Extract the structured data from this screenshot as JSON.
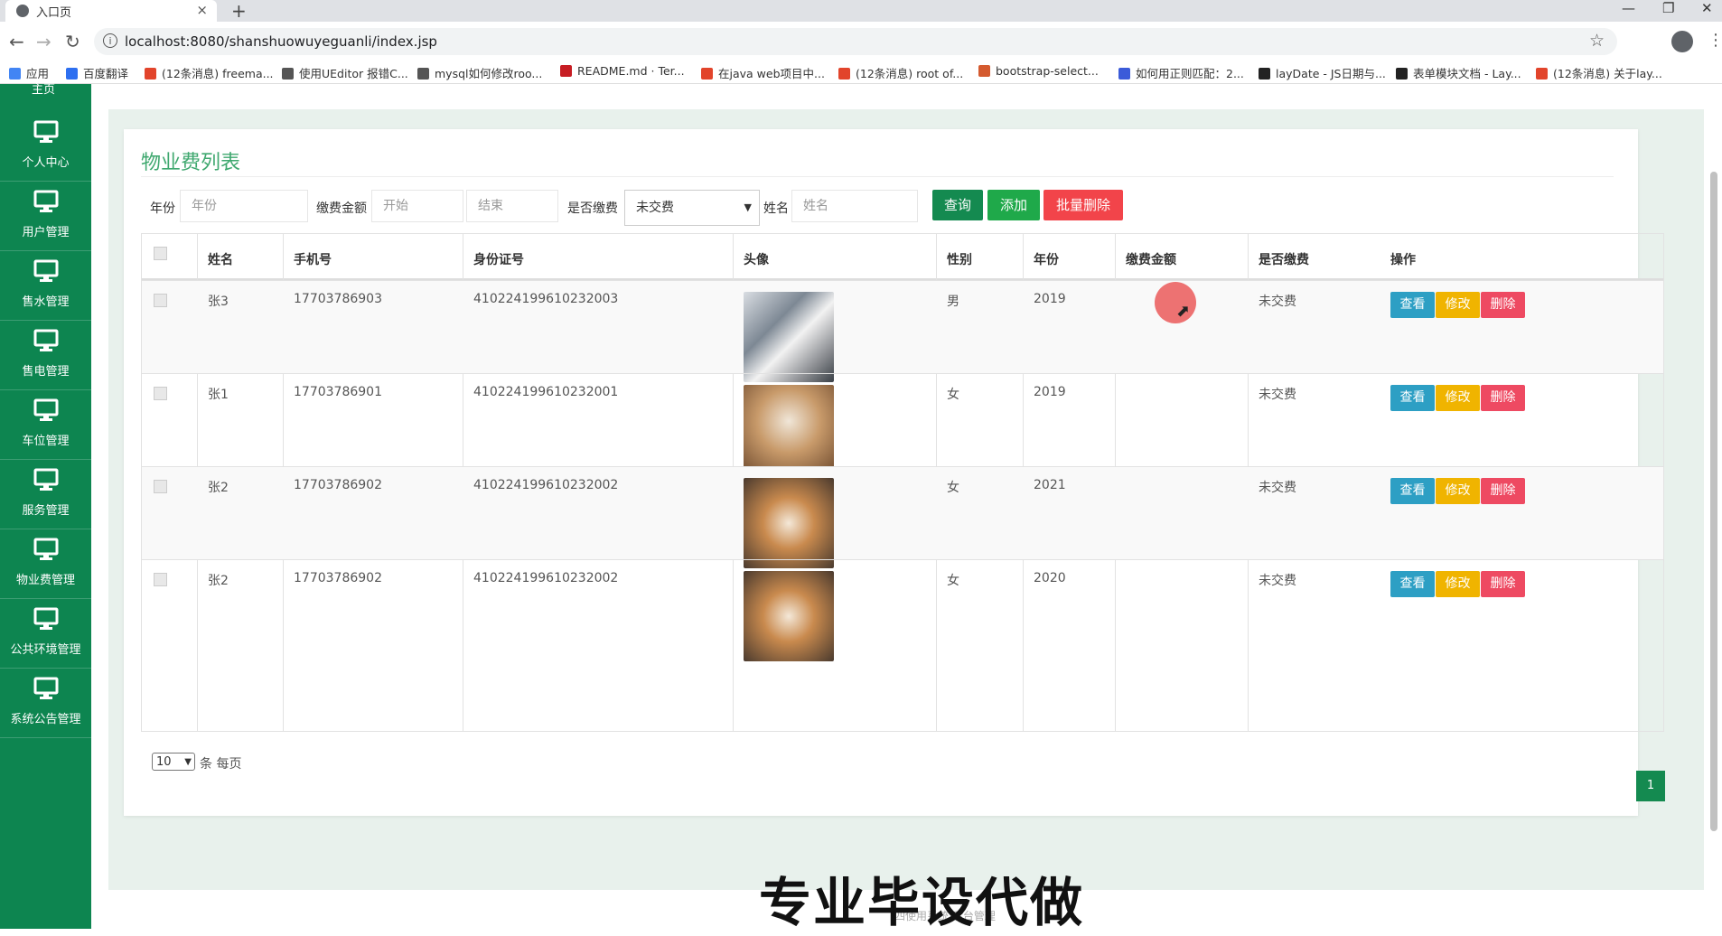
{
  "browser": {
    "tab_title": "入口页",
    "tab_close": "×",
    "new_tab": "+",
    "url": "localhost:8080/shanshuowuyeguanli/index.jsp",
    "bookmarks": [
      {
        "label": "应用",
        "color": "#4285f4"
      },
      {
        "label": "百度翻译",
        "color": "#2d6ff0"
      },
      {
        "label": "(12条消息) freema...",
        "color": "#e2442b"
      },
      {
        "label": "使用UEditor 报错C...",
        "color": "#555555"
      },
      {
        "label": "mysql如何修改roo...",
        "color": "#555555"
      },
      {
        "label": "README.md · Ter...",
        "color": "#c71d23"
      },
      {
        "label": "在java web项目中...",
        "color": "#e2442b"
      },
      {
        "label": "(12条消息) root of...",
        "color": "#e2442b"
      },
      {
        "label": "bootstrap-select...",
        "color": "#d45a2f"
      },
      {
        "label": "如何用正则匹配：2...",
        "color": "#3b5bd9"
      },
      {
        "label": "layDate - JS日期与...",
        "color": "#222222"
      },
      {
        "label": "表单模块文档 - Lay...",
        "color": "#222222"
      },
      {
        "label": "(12条消息) 关于lay...",
        "color": "#e2442b"
      }
    ]
  },
  "sidebar": {
    "top_stub": "主页",
    "items": [
      {
        "label": "个人中心"
      },
      {
        "label": "用户管理"
      },
      {
        "label": "售水管理"
      },
      {
        "label": "售电管理"
      },
      {
        "label": "车位管理"
      },
      {
        "label": "服务管理"
      },
      {
        "label": "物业费管理"
      },
      {
        "label": "公共环境管理"
      },
      {
        "label": "系统公告管理"
      }
    ]
  },
  "panel": {
    "title": "物业费列表"
  },
  "filter": {
    "year_label": "年份",
    "year_placeholder": "年份",
    "amount_label": "缴费金额",
    "amount_start_placeholder": "开始",
    "amount_end_placeholder": "结束",
    "paid_label": "是否缴费",
    "paid_selected": "未交费",
    "name_label": "姓名",
    "name_placeholder": "姓名",
    "search_button": "查询",
    "add_button": "添加",
    "batch_delete_button": "批量删除"
  },
  "table": {
    "headers": [
      "姓名",
      "手机号",
      "身份证号",
      "头像",
      "性别",
      "年份",
      "缴费金额",
      "是否缴费",
      "操作"
    ],
    "rows": [
      {
        "name": "张3",
        "phone": "17703786903",
        "id_card": "410224199610232003",
        "avatar": "husky",
        "gender": "男",
        "year": "2019",
        "amount": "",
        "paid": "未交费"
      },
      {
        "name": "张1",
        "phone": "17703786901",
        "id_card": "410224199610232001",
        "avatar": "cat",
        "gender": "女",
        "year": "2019",
        "amount": "",
        "paid": "未交费"
      },
      {
        "name": "张2",
        "phone": "17703786902",
        "id_card": "410224199610232002",
        "avatar": "shiba",
        "gender": "女",
        "year": "2021",
        "amount": "",
        "paid": "未交费"
      },
      {
        "name": "张2",
        "phone": "17703786902",
        "id_card": "410224199610232002",
        "avatar": "shiba",
        "gender": "女",
        "year": "2020",
        "amount": "",
        "paid": "未交费"
      }
    ],
    "actions": {
      "view": "查看",
      "edit": "修改",
      "delete": "删除"
    }
  },
  "pagination": {
    "page_size": "10",
    "per_page_label": "条 每页",
    "current_page": "1"
  },
  "overlay": {
    "watermark": "专业毕设代做",
    "footer_text": "四使用系统 后台管理"
  },
  "colors": {
    "sidebar": "#0d8550",
    "title": "#3fa86f",
    "btn_search": "#148a50",
    "btn_add": "#1fa94a",
    "btn_delete": "#f2444a",
    "btn_view": "#2d9fc4",
    "btn_edit": "#f0b400",
    "btn_remove": "#ee4a62"
  }
}
